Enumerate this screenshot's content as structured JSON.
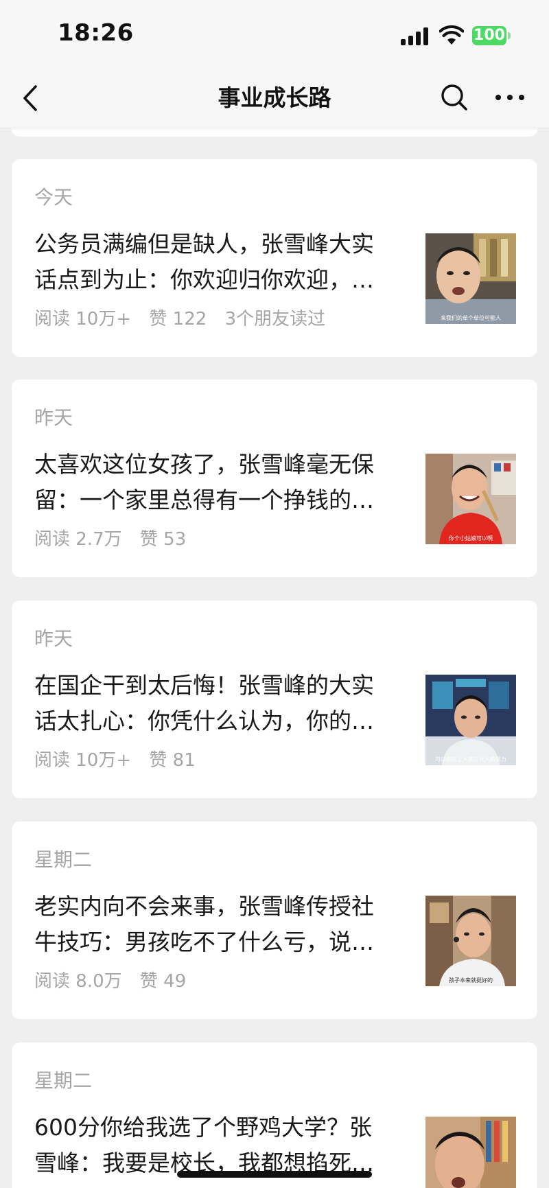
{
  "status": {
    "time": "18:26",
    "battery": "100"
  },
  "nav": {
    "title": "事业成长路",
    "icons": [
      "back-chevron-icon",
      "search-icon",
      "more-dots-icon"
    ]
  },
  "articles": [
    {
      "date": "今天",
      "title_line1": "公务员满编但是缺人，张雪峰大实",
      "title_line2": "话点到为止：你欢迎归你欢迎，…",
      "reads": "阅读 10万+",
      "likes": "赞 122",
      "friends": "3个朋友读过",
      "thumb_caption": "来我们的单个单位可能人"
    },
    {
      "date": "昨天",
      "title_line1": "太喜欢这位女孩了，张雪峰毫无保",
      "title_line2": "留：一个家里总得有一个挣钱的…",
      "reads": "阅读 2.7万",
      "likes": "赞 53",
      "friends": "",
      "thumb_caption": "你个小姑娘可以啊"
    },
    {
      "date": "昨天",
      "title_line1": "在国企干到太后悔！张雪峰的大实",
      "title_line2": "话太扎心：你凭什么认为，你的…",
      "reads": "阅读 10万+",
      "likes": "赞 81",
      "friends": "",
      "thumb_caption": "可以把这上人家三代人的努力"
    },
    {
      "date": "星期二",
      "title_line1": "老实内向不会来事，张雪峰传授社",
      "title_line2": "牛技巧：男孩吃不了什么亏，说…",
      "reads": "阅读 8.0万",
      "likes": "赞 49",
      "friends": "",
      "thumb_caption": "孩子本来就挺好的"
    },
    {
      "date": "星期二",
      "title_line1": "600分你给我选了个野鸡大学？张",
      "title_line2": "雪峰：我要是校长，我都想掐死…",
      "reads": "",
      "likes": "",
      "friends": "",
      "thumb_caption": ""
    }
  ],
  "colors": {
    "background": "#efefef",
    "card": "#ffffff",
    "muted_text": "#a5a5a5",
    "battery_green": "#4cd964"
  }
}
